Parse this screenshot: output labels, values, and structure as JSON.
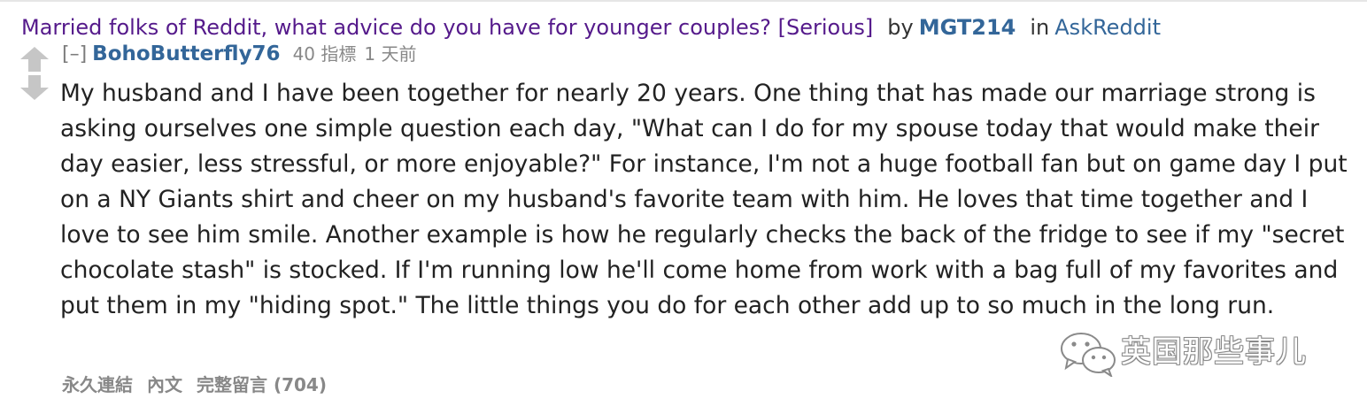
{
  "post": {
    "title": "Married folks of Reddit, what advice do you have for younger couples? [Serious]",
    "by_label": "by",
    "author": "MGT214",
    "in_label": "in",
    "subreddit": "AskReddit"
  },
  "comment": {
    "collapse_label": "[–]",
    "author": "BohoButterfly76",
    "score": "40 指標",
    "time": "1 天前",
    "body": "My husband and I have been together for nearly 20 years. One thing that has made our marriage strong is asking ourselves one simple question each day, \"What can I do for my spouse today that would make their day easier, less stressful, or more enjoyable?\" For instance, I'm not a huge football fan but on game day I put on a NY Giants shirt and cheer on my husband's favorite team with him. He loves that time together and I love to see him smile. Another example is how he regularly checks the back of the fridge to see if my \"secret chocolate stash\" is stocked. If I'm running low he'll come home from work with a bag full of my favorites and put them in my \"hiding spot.\" The little things you do for each other add up to so much in the long run."
  },
  "actions": {
    "permalink": "永久連結",
    "embed": "內文",
    "full_comments": "完整留言 (704)"
  },
  "watermark": {
    "text": "英国那些事儿",
    "icon": "wechat-icon"
  },
  "icons": {
    "upvote": "upvote-arrow-icon",
    "downvote": "downvote-arrow-icon"
  },
  "colors": {
    "title": "#551a8b",
    "link": "#336699",
    "muted": "#888888",
    "arrow": "#c6c6c6"
  }
}
